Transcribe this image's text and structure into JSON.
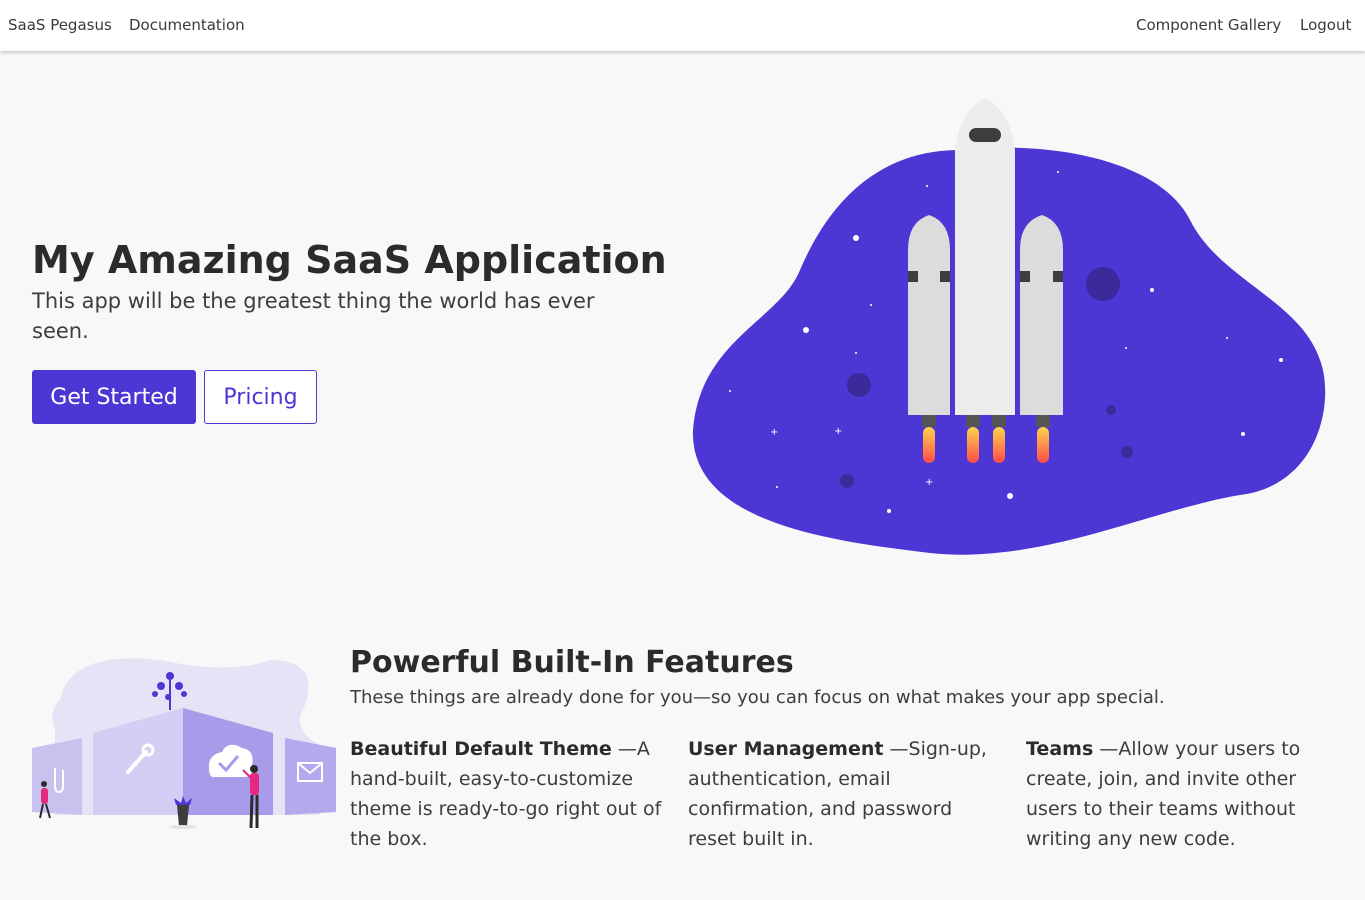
{
  "nav": {
    "brand": "SaaS Pegasus",
    "documentation": "Documentation",
    "component_gallery": "Component Gallery",
    "logout": "Logout"
  },
  "hero": {
    "title": "My Amazing SaaS Application",
    "subtitle": "This app will be the greatest thing the world has ever seen.",
    "primary_button": "Get Started",
    "secondary_button": "Pricing"
  },
  "features": {
    "title": "Powerful Built-In Features",
    "subtitle": "These things are already done for you—so you can focus on what makes your app special.",
    "items": [
      {
        "name": "Beautiful Default Theme",
        "description": "—A hand-built, easy-to-customize theme is ready-to-go right out of the box."
      },
      {
        "name": "User Management",
        "description": "—Sign-up, authentication, email confirmation, and password reset built in."
      },
      {
        "name": "Teams",
        "description": "—Allow your users to create, join, and invite other users to their teams without writing any new code."
      }
    ]
  },
  "colors": {
    "accent": "#4c36d4",
    "background": "#f8f8f8",
    "navbar": "#ffffff"
  },
  "icons": [
    "rocket-illustration",
    "features-illustration"
  ]
}
